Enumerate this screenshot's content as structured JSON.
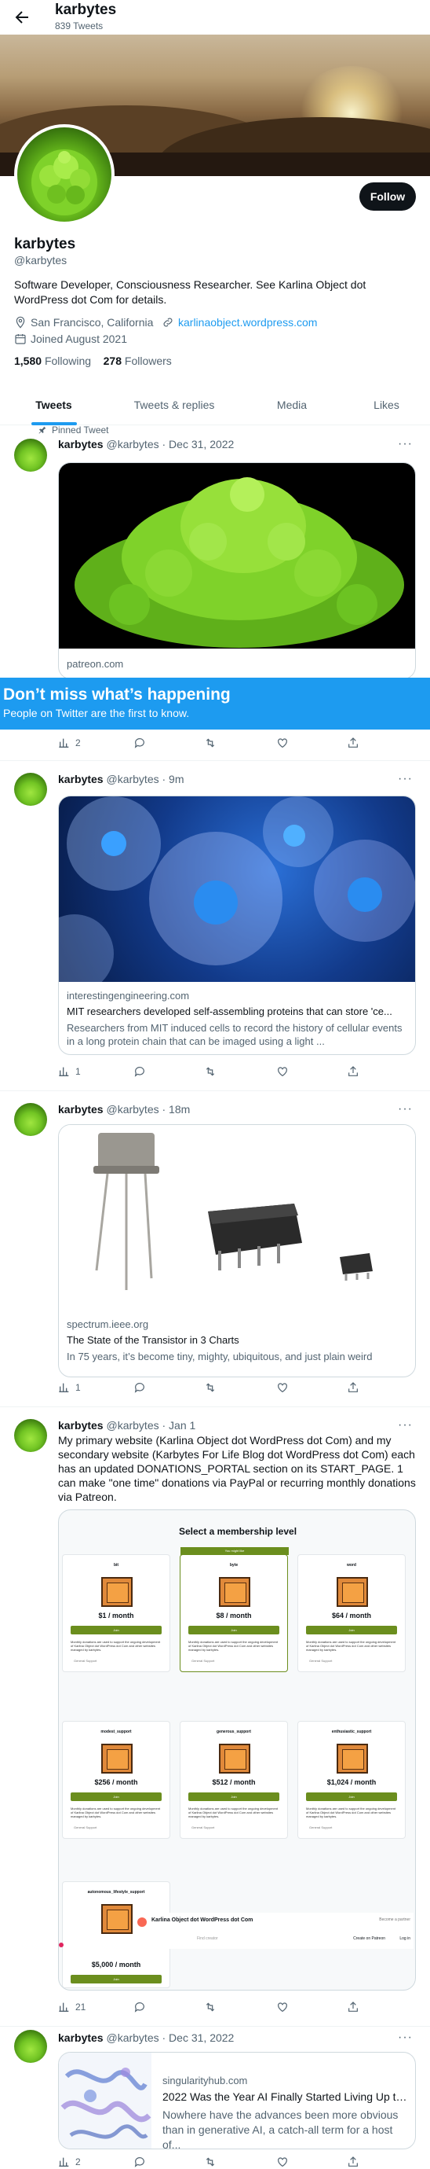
{
  "header": {
    "name": "karbytes",
    "tweet_count": "839 Tweets"
  },
  "profile": {
    "name": "karbytes",
    "handle": "@karbytes",
    "follow_label": "Follow",
    "bio": "Software Developer, Consciousness Researcher. See Karlina Object dot WordPress dot Com for details.",
    "location": "San Francisco, California",
    "website": "karlinaobject.wordpress.com",
    "joined": "Joined August 2021",
    "following_count": "1,580",
    "following_label": "Following",
    "followers_count": "278",
    "followers_label": "Followers"
  },
  "tabs": [
    "Tweets",
    "Tweets & replies",
    "Media",
    "Likes"
  ],
  "pinned_label": "Pinned Tweet",
  "banner": {
    "title": "Don’t miss what’s happening",
    "subtitle": "People on Twitter are the first to know."
  },
  "tweets": [
    {
      "name": "karbytes",
      "handle": "@karbytes",
      "time": "· Dec 31, 2022",
      "card_domain": "patreon.com",
      "replies": "",
      "retweets": "",
      "likes": "",
      "views": "2"
    },
    {
      "name": "karbytes",
      "handle": "@karbytes",
      "time": "· 9m",
      "card_domain": "interestingengineering.com",
      "card_title": "MIT researchers developed self-assembling proteins that can store 'ce...",
      "card_desc": "Researchers from MIT induced cells to record the history of cellular events in a long protein chain that can be imaged using a light ...",
      "views": "1"
    },
    {
      "name": "karbytes",
      "handle": "@karbytes",
      "time": "· 18m",
      "card_domain": "spectrum.ieee.org",
      "card_title": "The State of the Transistor in 3 Charts",
      "card_desc": "In 75 years, it’s become tiny, mighty, ubiquitous, and just plain weird",
      "views": "1"
    },
    {
      "name": "karbytes",
      "handle": "@karbytes",
      "time": "· Jan 1",
      "text": "My primary website (Karlina Object dot WordPress dot Com) and my secondary website (Karbytes For Life Blog dot WordPress dot Com) each has an updated DONATIONS_PORTAL section on its START_PAGE. 1 can make \"one time\" donations via PayPal or recurring monthly donations via Patreon.",
      "views": "21"
    },
    {
      "name": "karbytes",
      "handle": "@karbytes",
      "time": "· Dec 31, 2022",
      "card_domain": "singularityhub.com",
      "card_title": "2022 Was the Year AI Finally Started Living Up to I...",
      "card_desc": "Nowhere have the advances been more obvious than in generative AI, a catch-all term for a host of...",
      "views": "2"
    }
  ],
  "membership": {
    "title": "Select a membership level",
    "highlight_tag": "You might like",
    "join_label": "Join",
    "desc": "Monthly donations are used to support the ongoing development of Karlina Object dot WordPress dot Com and other websites managed by karbytes.",
    "foot": "General Support",
    "tiers": [
      {
        "name": "bit",
        "price": "$1 / month"
      },
      {
        "name": "byte",
        "price": "$8 / month"
      },
      {
        "name": "word",
        "price": "$64 / month"
      },
      {
        "name": "modest_support",
        "price": "$256 / month"
      },
      {
        "name": "generous_support",
        "price": "$512 / month"
      },
      {
        "name": "enthusiastic_support",
        "price": "$1,024 / month"
      },
      {
        "name": "autonomous_lifestyle_support",
        "price": "$5,000 / month"
      }
    ],
    "page_bar": {
      "creator": "Karlina Object dot WordPress dot Com",
      "search": "Find creator",
      "become_creator": "Become a partner",
      "create_patreon": "Create on Patreon",
      "login": "Log in"
    }
  }
}
